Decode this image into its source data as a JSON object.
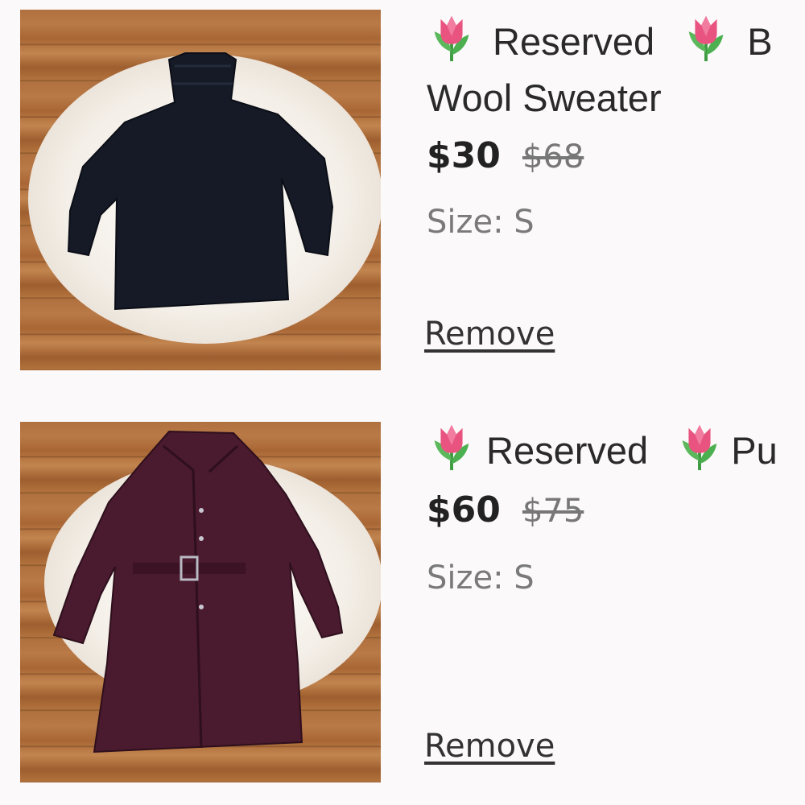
{
  "items": [
    {
      "title_line1": "Reserved",
      "title_line1_after": "B",
      "title_line2": "Wool Sweater",
      "price": "$30",
      "original_price": "$68",
      "size": "Size: S",
      "remove_label": "Remove",
      "image_icon": "black-turtleneck-sweater-photo"
    },
    {
      "title_line1": "Reserved",
      "title_line1_after": "Pu",
      "price": "$60",
      "original_price": "$75",
      "size": "Size: S",
      "remove_label": "Remove",
      "image_icon": "burgundy-belted-coat-photo"
    }
  ],
  "title_icon": "tulip-emoji-icon",
  "colors": {
    "background": "#fbf9fa",
    "price": "#222222",
    "original_price": "#777777",
    "size_text": "#7a7a7a",
    "sweater": "#151a26",
    "coat": "#4a1a2e",
    "tulip_petal": "#e8547f",
    "tulip_leaf": "#4caf50"
  }
}
